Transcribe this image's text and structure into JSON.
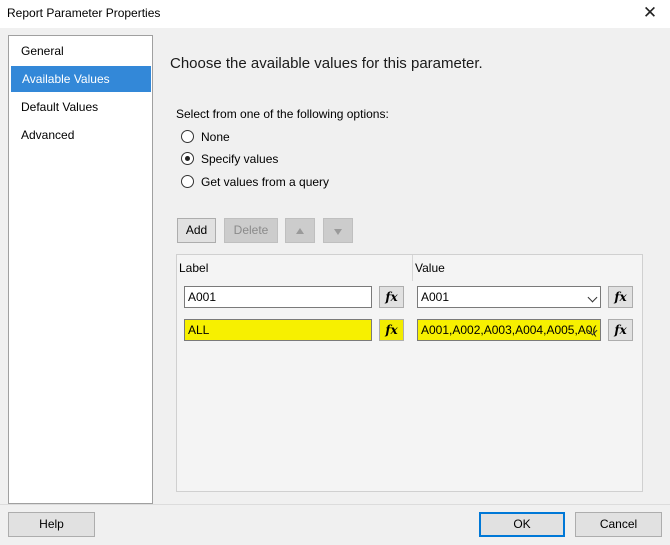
{
  "window": {
    "title": "Report Parameter Properties",
    "close_glyph": "✕"
  },
  "nav": {
    "items": [
      {
        "label": "General",
        "selected": false
      },
      {
        "label": "Available Values",
        "selected": true
      },
      {
        "label": "Default Values",
        "selected": false
      },
      {
        "label": "Advanced",
        "selected": false
      }
    ]
  },
  "main": {
    "heading": "Choose the available values for this parameter.",
    "options_label": "Select from one of the following options:",
    "options": [
      {
        "label": "None",
        "checked": false
      },
      {
        "label": "Specify values",
        "checked": true
      },
      {
        "label": "Get values from a query",
        "checked": false
      }
    ],
    "toolbar": {
      "add_label": "Add",
      "delete_label": "Delete",
      "move_up_icon": "arrow-up-icon",
      "move_down_icon": "arrow-down-icon"
    },
    "grid": {
      "label_header": "Label",
      "value_header": "Value",
      "fx_label": "fx",
      "highlight_color": "#f7f000",
      "rows": [
        {
          "label": "A001",
          "value": "A001",
          "highlighted": false
        },
        {
          "label": "ALL",
          "value": "A001,A002,A003,A004,A005,A0(",
          "highlighted": true
        }
      ]
    }
  },
  "footer": {
    "help_label": "Help",
    "ok_label": "OK",
    "cancel_label": "Cancel"
  },
  "colors": {
    "selection": "#3388d8",
    "dialog_bg": "#f0f0f0",
    "primary_border": "#0078d7"
  }
}
